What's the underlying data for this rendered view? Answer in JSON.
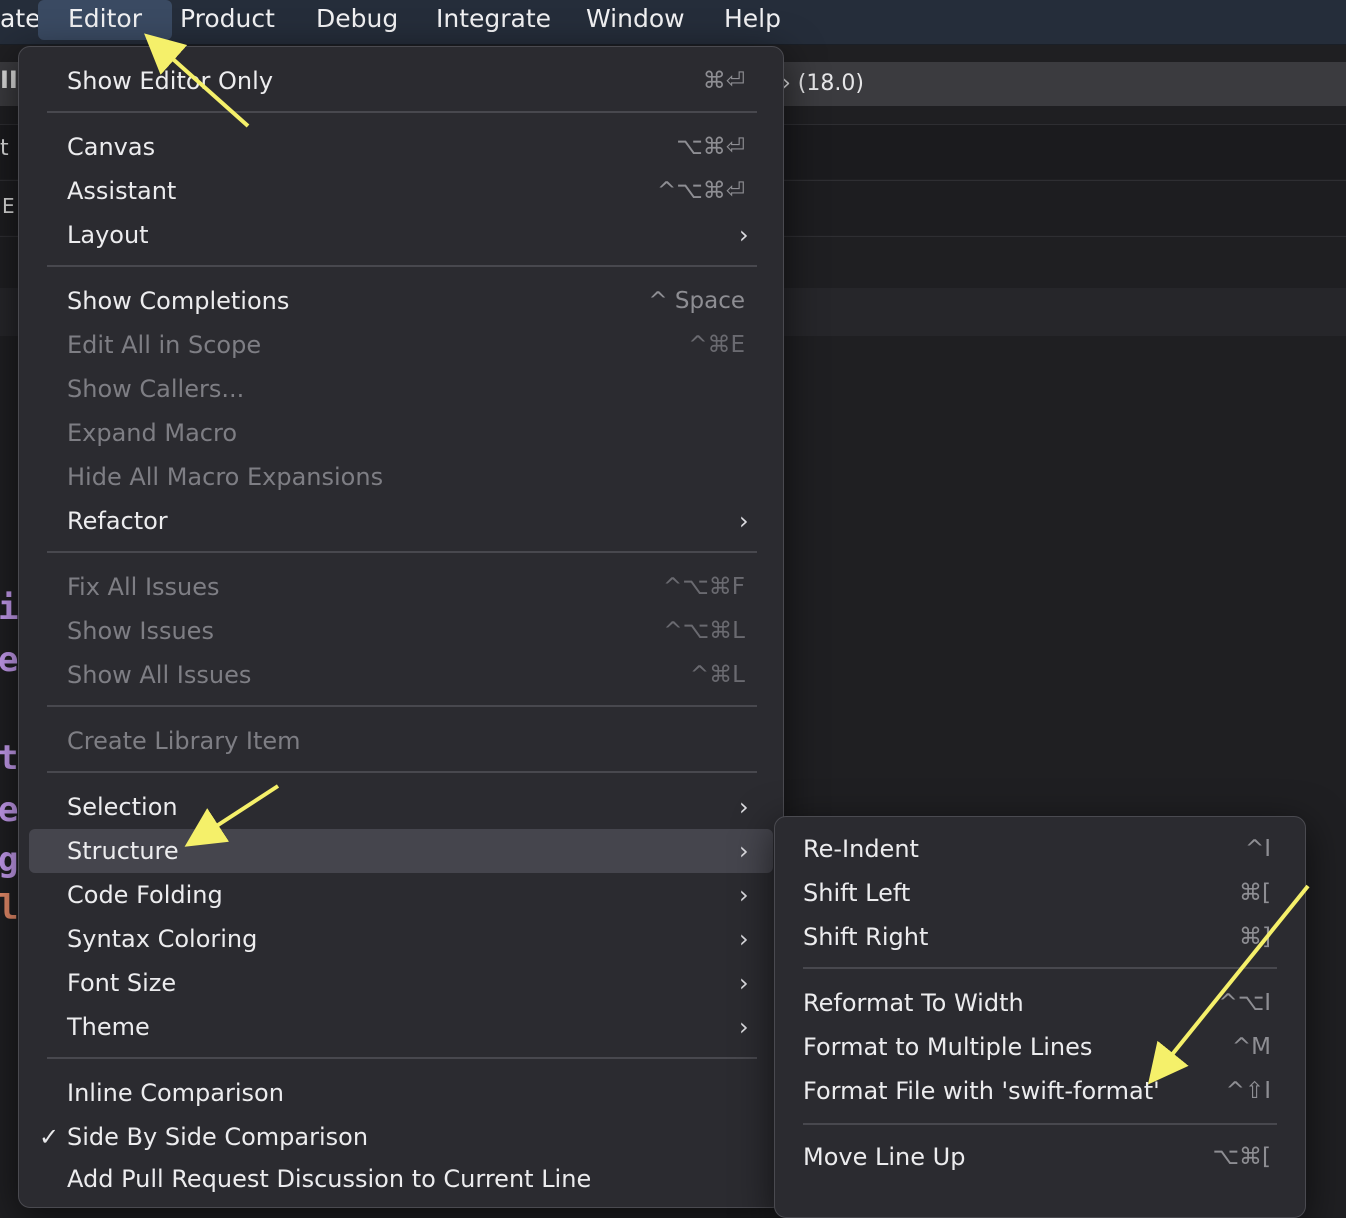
{
  "menubar": {
    "items": [
      {
        "label": "ate"
      },
      {
        "label": "Editor"
      },
      {
        "label": "Product"
      },
      {
        "label": "Debug"
      },
      {
        "label": "Integrate"
      },
      {
        "label": "Window"
      },
      {
        "label": "Help"
      }
    ]
  },
  "background": {
    "toolbar_text": "(18.0)",
    "left_fragments": [
      "II",
      "t",
      "E"
    ],
    "code_chars": [
      "i",
      "e",
      "t",
      "e",
      "g",
      "l"
    ]
  },
  "editor_menu": {
    "items": [
      {
        "label": "Show Editor Only",
        "shortcut": "⌘⏎",
        "enabled": true
      },
      {
        "label": "Canvas",
        "shortcut": "⌥⌘⏎",
        "enabled": true
      },
      {
        "label": "Assistant",
        "shortcut": "^⌥⌘⏎",
        "enabled": true
      },
      {
        "label": "Layout",
        "submenu": true,
        "enabled": true
      },
      {
        "label": "Show Completions",
        "shortcut": "^ Space",
        "enabled": true
      },
      {
        "label": "Edit All in Scope",
        "shortcut": "^⌘E",
        "enabled": false
      },
      {
        "label": "Show Callers...",
        "enabled": false
      },
      {
        "label": "Expand Macro",
        "enabled": false
      },
      {
        "label": "Hide All Macro Expansions",
        "enabled": false
      },
      {
        "label": "Refactor",
        "submenu": true,
        "enabled": true
      },
      {
        "label": "Fix All Issues",
        "shortcut": "^⌥⌘F",
        "enabled": false
      },
      {
        "label": "Show Issues",
        "shortcut": "^⌥⌘L",
        "enabled": false
      },
      {
        "label": "Show All Issues",
        "shortcut": "^⌘L",
        "enabled": false
      },
      {
        "label": "Create Library Item",
        "enabled": false
      },
      {
        "label": "Selection",
        "submenu": true,
        "enabled": true
      },
      {
        "label": "Structure",
        "submenu": true,
        "enabled": true,
        "highlighted": true
      },
      {
        "label": "Code Folding",
        "submenu": true,
        "enabled": true
      },
      {
        "label": "Syntax Coloring",
        "submenu": true,
        "enabled": true
      },
      {
        "label": "Font Size",
        "submenu": true,
        "enabled": true
      },
      {
        "label": "Theme",
        "submenu": true,
        "enabled": true
      },
      {
        "label": "Inline Comparison",
        "enabled": true
      },
      {
        "label": "Side By Side Comparison",
        "enabled": true,
        "checked": true
      },
      {
        "label": "Add Pull Request Discussion to Current Line",
        "enabled": true
      }
    ],
    "chevron": "›",
    "checkmark": "✓"
  },
  "structure_menu": {
    "items": [
      {
        "label": "Re-Indent",
        "shortcut": "^I"
      },
      {
        "label": "Shift Left",
        "shortcut": "⌘["
      },
      {
        "label": "Shift Right",
        "shortcut": "⌘]"
      },
      {
        "label": "Reformat To Width",
        "shortcut": "^⌥I"
      },
      {
        "label": "Format to Multiple Lines",
        "shortcut": "^M"
      },
      {
        "label": "Format File with 'swift-format'",
        "shortcut": "^⇧I"
      },
      {
        "label": "Move Line Up",
        "shortcut": "⌥⌘["
      }
    ]
  },
  "annotation_color": "#f5f06a"
}
